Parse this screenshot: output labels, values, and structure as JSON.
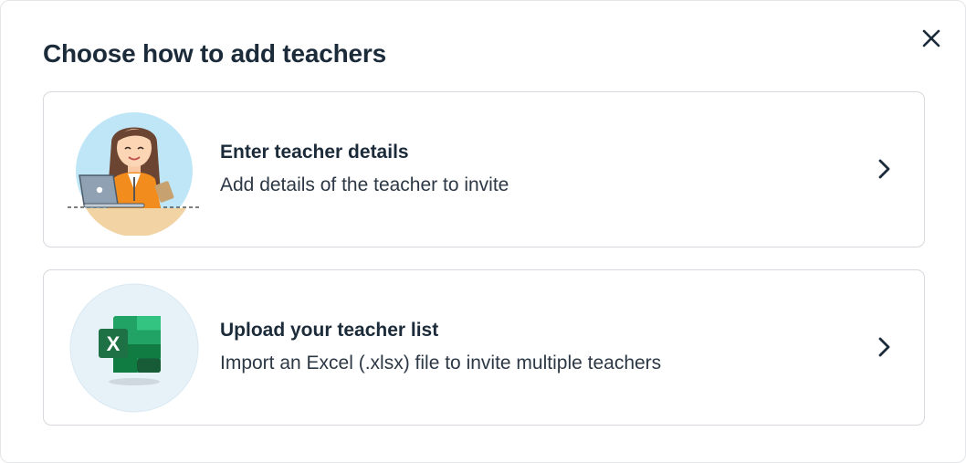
{
  "dialog": {
    "title": "Choose how to add teachers",
    "close_icon": "close-icon"
  },
  "options": [
    {
      "title": "Enter teacher details",
      "description": "Add details of the teacher to invite",
      "illustration": "teacher-at-laptop-illustration",
      "chevron_icon": "chevron-right-icon"
    },
    {
      "title": "Upload your teacher list",
      "description": "Import an Excel (.xlsx) file to invite multiple teachers",
      "illustration": "excel-file-icon",
      "chevron_icon": "chevron-right-icon"
    }
  ],
  "colors": {
    "text_primary": "#1c2b3a",
    "card_border": "#d6d9dd",
    "illus_bg_teacher": "#bfe6f7",
    "illus_bg_excel": "#e6f1f8",
    "excel_green": "#1e7145"
  }
}
